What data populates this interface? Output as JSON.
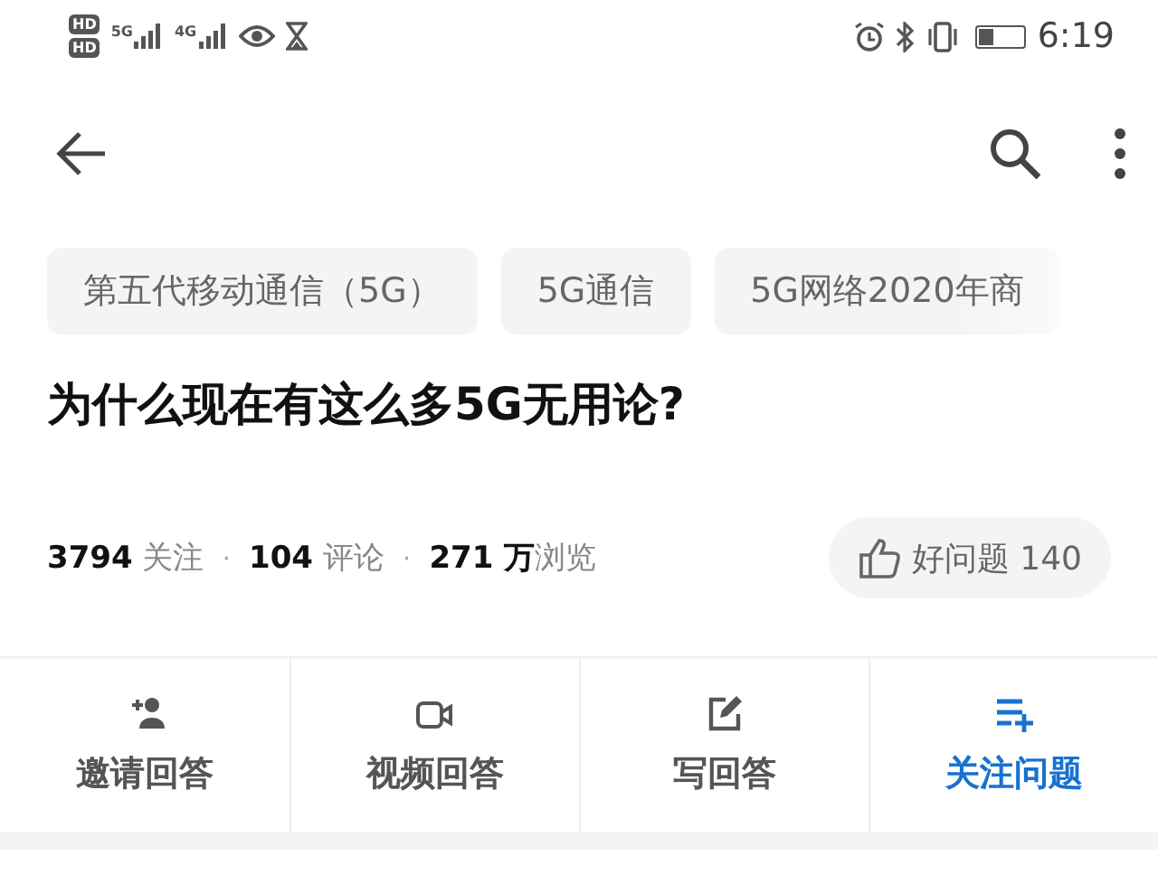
{
  "status_bar": {
    "sim_labels": [
      "HD",
      "HD"
    ],
    "networks": [
      "5G",
      "4G"
    ],
    "time": "6:19"
  },
  "tags": [
    "第五代移动通信（5G）",
    "5G通信",
    "5G网络2020年商"
  ],
  "title": "为什么现在有这么多5G无用论?",
  "stats": [
    {
      "text": "**3794** 关注"
    },
    {
      "separator": "·",
      "text": "**104** 评论"
    },
    {
      "separator": "·",
      "text": "**271 万**浏览"
    }
  ],
  "good_question": {
    "label": "好问题 140"
  },
  "actions": [
    {
      "kind": "invite",
      "label": "邀请回答",
      "active": false
    },
    {
      "kind": "video",
      "label": "视频回答",
      "active": false
    },
    {
      "kind": "write",
      "label": "写回答",
      "active": false
    },
    {
      "kind": "follow",
      "label": "关注问题",
      "active": true
    }
  ]
}
